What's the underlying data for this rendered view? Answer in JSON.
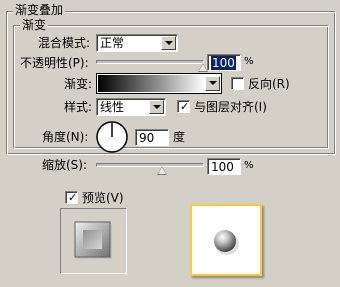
{
  "panel": {
    "title": "渐变叠加",
    "section_title": "渐变"
  },
  "blend_mode": {
    "label": "混合模式:",
    "value": "正常"
  },
  "opacity": {
    "label": "不透明性(P):",
    "value": "100",
    "unit": "%",
    "level": 1.0
  },
  "gradient": {
    "label": "渐变:",
    "reverse_label": "反向(R)",
    "reverse_checked": false
  },
  "style": {
    "label": "样式:",
    "value": "线性",
    "align_label": "与图层对齐(I)",
    "align_checked": true
  },
  "angle": {
    "label": "角度(N):",
    "value": "90",
    "unit": "度"
  },
  "scale": {
    "label": "缩放(S):",
    "value": "100",
    "unit": "%",
    "level": 0.5
  },
  "preview": {
    "label": "预览(V)",
    "checked": true
  },
  "colors": {
    "accent": "#ffcc33",
    "selection": "#0a246a",
    "face": "#d4d0c8"
  },
  "icons": {
    "checkmark": "✓"
  }
}
